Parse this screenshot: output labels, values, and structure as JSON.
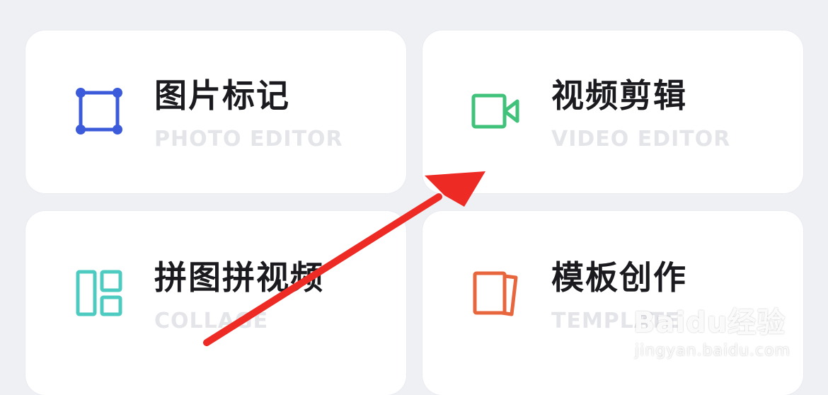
{
  "cards": [
    {
      "title": "图片标记",
      "subtitle": "PHOTO EDITOR",
      "icon": "crop-frame-icon",
      "icon_color": "#3b5bdb"
    },
    {
      "title": "视频剪辑",
      "subtitle": "VIDEO EDITOR",
      "icon": "video-camera-icon",
      "icon_color": "#40c27a"
    },
    {
      "title": "拼图拼视频",
      "subtitle": "COLLAGE",
      "icon": "collage-layout-icon",
      "icon_color": "#4ecbc0"
    },
    {
      "title": "模板创作",
      "subtitle": "TEMPLATE",
      "icon": "template-pages-icon",
      "icon_color": "#e8663d"
    }
  ],
  "annotation": {
    "color": "#ee2a24",
    "icon": "red-arrow-icon"
  },
  "watermark": {
    "brand": "Baidu经验",
    "url": "jingyan.baidu.com"
  },
  "colors": {
    "background": "#eff0f4",
    "card": "#ffffff",
    "title": "#1b1b1f",
    "subtitle": "#e4e5e9"
  }
}
